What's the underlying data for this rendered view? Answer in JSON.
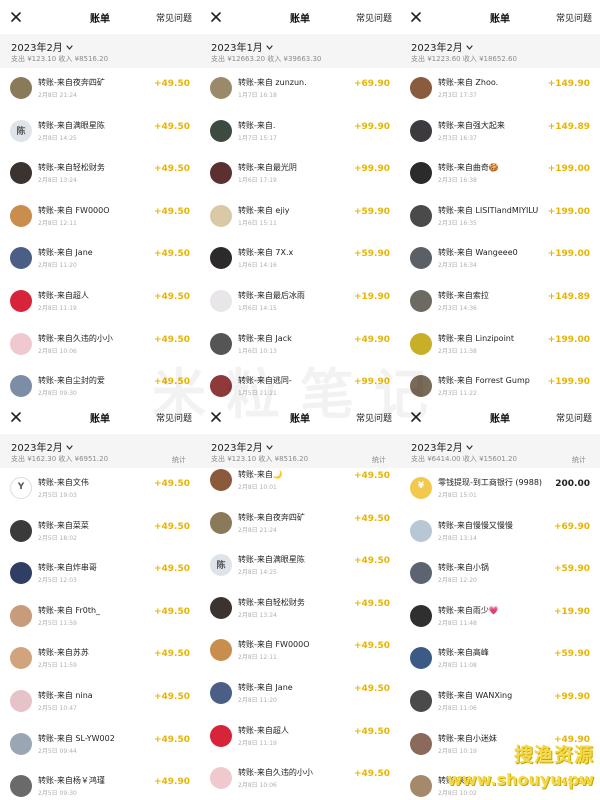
{
  "colors": {
    "income": "#e8b400",
    "expense": "#222222",
    "muted": "#8c8c8c",
    "summary_bg": "#f5f5f5"
  },
  "watermark": {
    "center_text": "米粒笔记",
    "corner_line1": "搜渔资源",
    "corner_line2": "www.shouyu.pw"
  },
  "panels": [
    {
      "title": "账单",
      "faq": "常见问题",
      "month": "2023年2月",
      "summary": "支出 ¥123.10 收入 ¥8516.20",
      "stats": "",
      "transactions": [
        {
          "title": "转账-来自夜奔四矿",
          "time": "2月8日 21:24",
          "amount": "+49.50",
          "avatar_color": "#8a7a5a",
          "avatar_char": ""
        },
        {
          "title": "转账-来自满眼星陈",
          "time": "2月8日 14:25",
          "amount": "+49.50",
          "avatar_color": "#dfe3ea",
          "avatar_char": "陈"
        },
        {
          "title": "转账-来自轻松财务",
          "time": "2月8日 13:24",
          "amount": "+49.50",
          "avatar_color": "#3a3330",
          "avatar_char": ""
        },
        {
          "title": "转账-来自 FW000O",
          "time": "2月8日 12:11",
          "amount": "+49.50",
          "avatar_color": "#c98d4e",
          "avatar_char": ""
        },
        {
          "title": "转账-来自 Jane",
          "time": "2月8日 11:20",
          "amount": "+49.50",
          "avatar_color": "#4a5e86",
          "avatar_char": ""
        },
        {
          "title": "转账-来自超人",
          "time": "2月8日 11:19",
          "amount": "+49.50",
          "avatar_color": "#d8243a",
          "avatar_char": ""
        },
        {
          "title": "转账-来自久违的小小",
          "time": "2月8日 10:06",
          "amount": "+49.50",
          "avatar_color": "#f0c9cf",
          "avatar_char": ""
        },
        {
          "title": "转账-来自尘封的爱",
          "time": "2月8日 09:30",
          "amount": "+49.50",
          "avatar_color": "#7b8ea6",
          "avatar_char": ""
        }
      ]
    },
    {
      "title": "账单",
      "faq": "常见问题",
      "month": "2023年1月",
      "summary": "支出 ¥12663.20 收入 ¥39663.30",
      "stats": "",
      "transactions": [
        {
          "title": "转账-来自 zunzun.",
          "time": "1月7日 16:18",
          "amount": "+69.90",
          "avatar_color": "#9b8a6a",
          "avatar_char": ""
        },
        {
          "title": "转账-来自.",
          "time": "1月7日 15:17",
          "amount": "+99.90",
          "avatar_color": "#3d4a3f",
          "avatar_char": ""
        },
        {
          "title": "转账-来自最光阴",
          "time": "1月6日 17:19",
          "amount": "+99.90",
          "avatar_color": "#5c2f31",
          "avatar_char": ""
        },
        {
          "title": "转账-来自 ejiy",
          "time": "1月6日 15:11",
          "amount": "+59.90",
          "avatar_color": "#d9c9a6",
          "avatar_char": ""
        },
        {
          "title": "转账-来自 7X.x",
          "time": "1月6日 14:16",
          "amount": "+59.90",
          "avatar_color": "#2d2a2c",
          "avatar_char": ""
        },
        {
          "title": "转账-来自最后冰雨",
          "time": "1月6日 14:15",
          "amount": "+19.90",
          "avatar_color": "#e8e6e9",
          "avatar_char": ""
        },
        {
          "title": "转账-来自 Jack",
          "time": "1月6日 10:13",
          "amount": "+49.90",
          "avatar_color": "#555555",
          "avatar_char": ""
        },
        {
          "title": "转账-来自逃同-",
          "time": "1月5日 21:21",
          "amount": "+99.90",
          "avatar_color": "#8e3a3a",
          "avatar_char": ""
        }
      ]
    },
    {
      "title": "账单",
      "faq": "常见问题",
      "month": "2023年2月",
      "summary": "支出 ¥1223.60 收入 ¥18652.60",
      "stats": "",
      "transactions": [
        {
          "title": "转账-来自 Zhoo.",
          "time": "2月3日 17:37",
          "amount": "+149.90",
          "avatar_color": "#8a5b3e",
          "avatar_char": ""
        },
        {
          "title": "转账-来自强大起来",
          "time": "2月3日 16:37",
          "amount": "+149.89",
          "avatar_color": "#3c3a3e",
          "avatar_char": ""
        },
        {
          "title": "转账-来自曲奇🍪",
          "time": "2月3日 16:38",
          "amount": "+199.00",
          "avatar_color": "#2b2b2b",
          "avatar_char": ""
        },
        {
          "title": "转账-来自 LISITlandMIYILU",
          "time": "2月3日 16:35",
          "amount": "+199.00",
          "avatar_color": "#4a4a4a",
          "avatar_char": ""
        },
        {
          "title": "转账-来自 Wangeee0",
          "time": "2月3日 16:34",
          "amount": "+199.00",
          "avatar_color": "#5b5f66",
          "avatar_char": ""
        },
        {
          "title": "转账-来自索拉",
          "time": "2月3日 14:36",
          "amount": "+149.89",
          "avatar_color": "#6d6a62",
          "avatar_char": ""
        },
        {
          "title": "转账-来自 Linzipoint",
          "time": "2月3日 11:38",
          "amount": "+199.00",
          "avatar_color": "#c7b028",
          "avatar_char": ""
        },
        {
          "title": "转账-来自 Forrest Gump",
          "time": "2月3日 11:22",
          "amount": "+199.90",
          "avatar_color": "#7a6a58",
          "avatar_char": ""
        }
      ]
    },
    {
      "title": "账单",
      "faq": "常见问题",
      "month": "2023年2月",
      "summary": "支出 ¥162.30 收入 ¥6951.20",
      "stats": "统计",
      "transactions": [
        {
          "title": "转账-来自文伟",
          "time": "2月5日 19:03",
          "amount": "+49.50",
          "avatar_color": "#ffffff",
          "avatar_char": "Y"
        },
        {
          "title": "转账-来自菜菜",
          "time": "2月5日 18:02",
          "amount": "+49.50",
          "avatar_color": "#3a3a3a",
          "avatar_char": ""
        },
        {
          "title": "转账-来自炸串哥",
          "time": "2月5日 12:03",
          "amount": "+49.50",
          "avatar_color": "#2e3f63",
          "avatar_char": ""
        },
        {
          "title": "转账-来自 Fr0th_",
          "time": "2月5日 11:59",
          "amount": "+49.50",
          "avatar_color": "#c89b7b",
          "avatar_char": ""
        },
        {
          "title": "转账-来自苏苏",
          "time": "2月5日 11:59",
          "amount": "+49.50",
          "avatar_color": "#d2a47d",
          "avatar_char": ""
        },
        {
          "title": "转账-来自 nina",
          "time": "2月5日 10:47",
          "amount": "+49.50",
          "avatar_color": "#e6c2c9",
          "avatar_char": ""
        },
        {
          "title": "转账-来自 SL-YW002",
          "time": "2月5日 09:44",
          "amount": "+49.50",
          "avatar_color": "#9aa6b4",
          "avatar_char": ""
        },
        {
          "title": "转账-来自杨￥鸿瑾",
          "time": "2月5日 09:30",
          "amount": "+49.90",
          "avatar_color": "#6a6a6a",
          "avatar_char": ""
        }
      ]
    },
    {
      "title": "账单",
      "faq": "常见问题",
      "month": "2023年2月",
      "summary": "支出 ¥123.10 收入 ¥8516.20",
      "stats": "统计",
      "transactions": [
        {
          "title": "转账-来自🌙",
          "time": "2月8日 10:01",
          "amount": "+49.50",
          "avatar_color": "#8a5a3a",
          "avatar_char": ""
        },
        {
          "title": "转账-来自夜奔四矿",
          "time": "2月8日 21:24",
          "amount": "+49.50",
          "avatar_color": "#8a7a5a",
          "avatar_char": ""
        },
        {
          "title": "转账-来自满眼星陈",
          "time": "2月8日 14:25",
          "amount": "+49.50",
          "avatar_color": "#dfe3ea",
          "avatar_char": "陈"
        },
        {
          "title": "转账-来自轻松财务",
          "time": "2月8日 13:24",
          "amount": "+49.50",
          "avatar_color": "#3a3330",
          "avatar_char": ""
        },
        {
          "title": "转账-来自 FW000O",
          "time": "2月8日 12:11",
          "amount": "+49.50",
          "avatar_color": "#c98d4e",
          "avatar_char": ""
        },
        {
          "title": "转账-来自 Jane",
          "time": "2月8日 11:20",
          "amount": "+49.50",
          "avatar_color": "#4a5e86",
          "avatar_char": ""
        },
        {
          "title": "转账-来自超人",
          "time": "2月8日 11:19",
          "amount": "+49.50",
          "avatar_color": "#d8243a",
          "avatar_char": ""
        },
        {
          "title": "转账-来自久违的小小",
          "time": "2月8日 10:06",
          "amount": "+49.50",
          "avatar_color": "#f0c9cf",
          "avatar_char": ""
        }
      ]
    },
    {
      "title": "账单",
      "faq": "常见问题",
      "month": "2023年2月",
      "summary": "支出 ¥6414.00 收入 ¥15601.20",
      "stats": "统计",
      "transactions": [
        {
          "title": "零钱提现-到工商银行 (9988)",
          "time": "2月8日 15:01",
          "amount": "200.00",
          "avatar_color": "#f2c94c",
          "avatar_char": "¥",
          "expense": true
        },
        {
          "title": "转账-来自慢慢又慢慢",
          "time": "2月8日 13:14",
          "amount": "+69.90",
          "avatar_color": "#b9c6d6",
          "avatar_char": ""
        },
        {
          "title": "转账-来自小锅",
          "time": "2月8日 12:20",
          "amount": "+59.90",
          "avatar_color": "#5c6470",
          "avatar_char": ""
        },
        {
          "title": "转账-来自雨少💗",
          "time": "2月8日 11:48",
          "amount": "+19.90",
          "avatar_color": "#2f2f2f",
          "avatar_char": ""
        },
        {
          "title": "转账-来自高峰",
          "time": "2月8日 11:08",
          "amount": "+59.90",
          "avatar_color": "#3b5b86",
          "avatar_char": ""
        },
        {
          "title": "转账-来自 WANXing",
          "time": "2月8日 11:06",
          "amount": "+99.90",
          "avatar_color": "#4a4a4a",
          "avatar_char": ""
        },
        {
          "title": "转账-来自小迷妹",
          "time": "2月8日 10:19",
          "amount": "+49.90",
          "avatar_color": "#8a6a5a",
          "avatar_char": ""
        },
        {
          "title": "转账-来自",
          "time": "2月8日 10:02",
          "amount": "+49.90",
          "avatar_color": "#a48a6a",
          "avatar_char": ""
        }
      ]
    }
  ]
}
